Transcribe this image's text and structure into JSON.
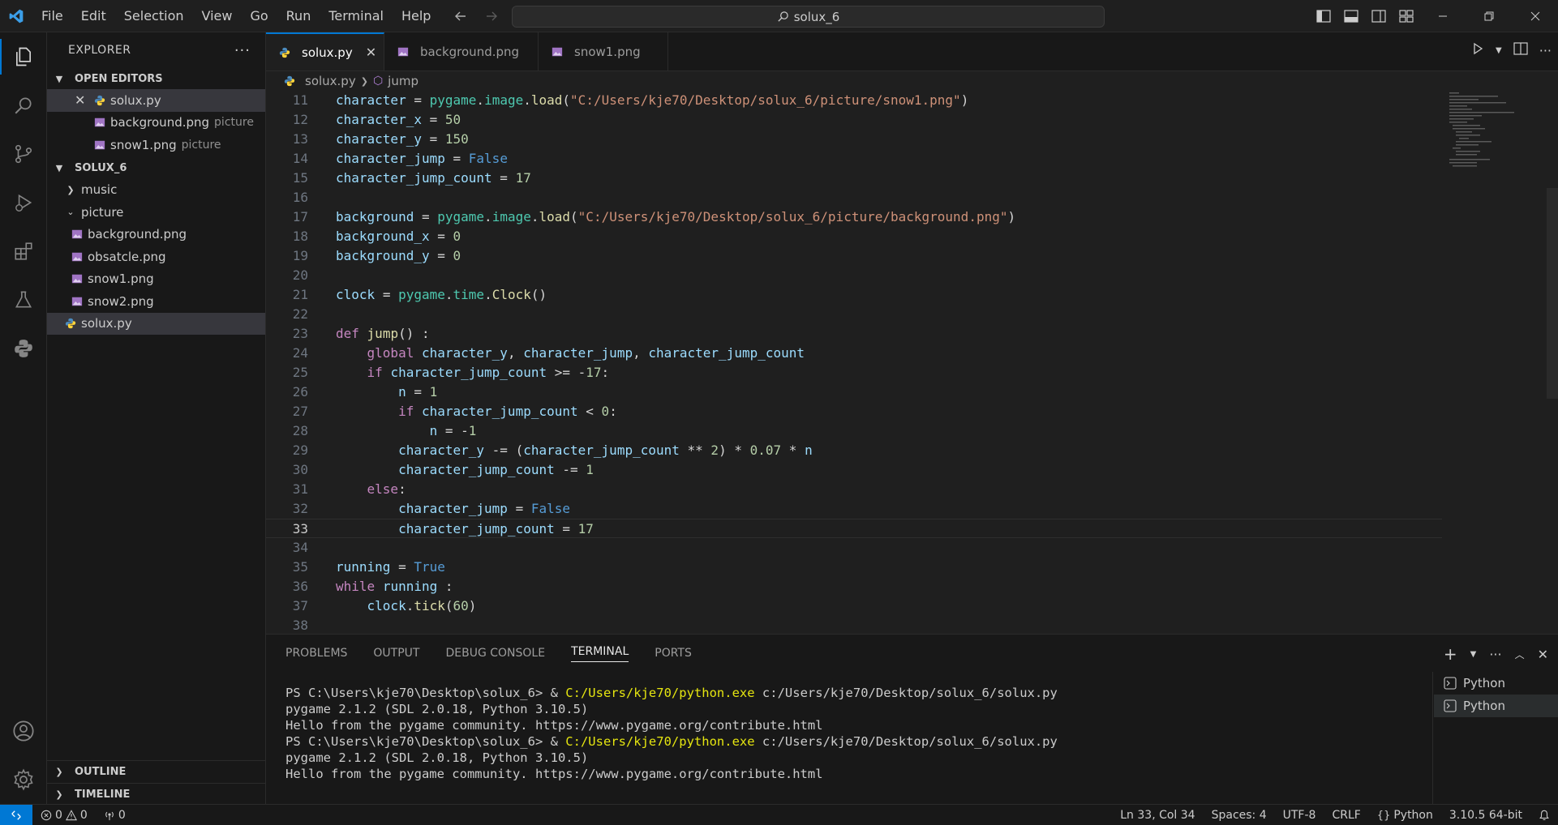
{
  "menu": [
    "File",
    "Edit",
    "Selection",
    "View",
    "Go",
    "Run",
    "Terminal",
    "Help"
  ],
  "command_center": {
    "text": "solux_6"
  },
  "sidebar": {
    "title": "EXPLORER",
    "open_editors_label": "OPEN EDITORS",
    "open_editors": [
      {
        "name": "solux.py",
        "desc": ""
      },
      {
        "name": "background.png",
        "desc": "picture"
      },
      {
        "name": "snow1.png",
        "desc": "picture"
      }
    ],
    "project_label": "SOLUX_6",
    "tree": [
      {
        "name": "music",
        "type": "folder",
        "depth": 0
      },
      {
        "name": "picture",
        "type": "folder-open",
        "depth": 0
      },
      {
        "name": "background.png",
        "type": "image",
        "depth": 1
      },
      {
        "name": "obsatcle.png",
        "type": "image",
        "depth": 1
      },
      {
        "name": "snow1.png",
        "type": "image",
        "depth": 1
      },
      {
        "name": "snow2.png",
        "type": "image",
        "depth": 1
      },
      {
        "name": "solux.py",
        "type": "python",
        "depth": 0
      }
    ],
    "outline_label": "OUTLINE",
    "timeline_label": "TIMELINE"
  },
  "tabs": [
    {
      "name": "solux.py",
      "active": true
    },
    {
      "name": "background.png",
      "active": false
    },
    {
      "name": "snow1.png",
      "active": false
    }
  ],
  "breadcrumb": {
    "file": "solux.py",
    "symbol": "jump"
  },
  "code": [
    {
      "n": "11",
      "text": "character = pygame.image.load(\"C:/Users/kje70/Desktop/solux_6/picture/snow1.png\")"
    },
    {
      "n": "12",
      "text": "character_x = 50"
    },
    {
      "n": "13",
      "text": "character_y = 150"
    },
    {
      "n": "14",
      "text": "character_jump = False"
    },
    {
      "n": "15",
      "text": "character_jump_count = 17"
    },
    {
      "n": "16",
      "text": ""
    },
    {
      "n": "17",
      "text": "background = pygame.image.load(\"C:/Users/kje70/Desktop/solux_6/picture/background.png\")"
    },
    {
      "n": "18",
      "text": "background_x = 0"
    },
    {
      "n": "19",
      "text": "background_y = 0"
    },
    {
      "n": "20",
      "text": ""
    },
    {
      "n": "21",
      "text": "clock = pygame.time.Clock()"
    },
    {
      "n": "22",
      "text": ""
    },
    {
      "n": "23",
      "text": "def jump() :"
    },
    {
      "n": "24",
      "text": "    global character_y, character_jump, character_jump_count"
    },
    {
      "n": "25",
      "text": "    if character_jump_count >= -17:"
    },
    {
      "n": "26",
      "text": "        n = 1"
    },
    {
      "n": "27",
      "text": "        if character_jump_count < 0:"
    },
    {
      "n": "28",
      "text": "            n = -1"
    },
    {
      "n": "29",
      "text": "        character_y -= (character_jump_count ** 2) * 0.07 * n"
    },
    {
      "n": "30",
      "text": "        character_jump_count -= 1"
    },
    {
      "n": "31",
      "text": "    else:"
    },
    {
      "n": "32",
      "text": "        character_jump = False"
    },
    {
      "n": "33",
      "text": "        character_jump_count = 17"
    },
    {
      "n": "34",
      "text": ""
    },
    {
      "n": "35",
      "text": "running = True"
    },
    {
      "n": "36",
      "text": "while running :"
    },
    {
      "n": "37",
      "text": "    clock.tick(60)"
    },
    {
      "n": "38",
      "text": ""
    }
  ],
  "current_line": "33",
  "panel": {
    "tabs": [
      "PROBLEMS",
      "OUTPUT",
      "DEBUG CONSOLE",
      "TERMINAL",
      "PORTS"
    ],
    "active_tab": "TERMINAL",
    "terminal_lines": [
      {
        "prompt": "PS C:\\Users\\kje70\\Desktop\\solux_6> & ",
        "cmd": "C:/Users/kje70/python.exe",
        "rest": " c:/Users/kje70/Desktop/solux_6/solux.py"
      },
      {
        "prompt": "pygame 2.1.2 (SDL 2.0.18, Python 3.10.5)",
        "cmd": "",
        "rest": ""
      },
      {
        "prompt": "Hello from the pygame community. https://www.pygame.org/contribute.html",
        "cmd": "",
        "rest": ""
      },
      {
        "prompt": "PS C:\\Users\\kje70\\Desktop\\solux_6> & ",
        "cmd": "C:/Users/kje70/python.exe",
        "rest": " c:/Users/kje70/Desktop/solux_6/solux.py"
      },
      {
        "prompt": "pygame 2.1.2 (SDL 2.0.18, Python 3.10.5)",
        "cmd": "",
        "rest": ""
      },
      {
        "prompt": "Hello from the pygame community. https://www.pygame.org/contribute.html",
        "cmd": "",
        "rest": ""
      }
    ],
    "terminals": [
      "Python",
      "Python"
    ]
  },
  "status": {
    "errors": "0",
    "warnings": "0",
    "ports": "0",
    "position": "Ln 33, Col 34",
    "spaces": "Spaces: 4",
    "encoding": "UTF-8",
    "eol": "CRLF",
    "language": "Python",
    "interpreter": "3.10.5 64-bit"
  },
  "colors": {
    "accent": "#0078d4",
    "keyword": "#c586c0",
    "function": "#dcdcaa",
    "string": "#ce9178",
    "number": "#b5cea8",
    "variable": "#9cdcfe",
    "module": "#4ec9b0",
    "constant": "#569cd6"
  }
}
